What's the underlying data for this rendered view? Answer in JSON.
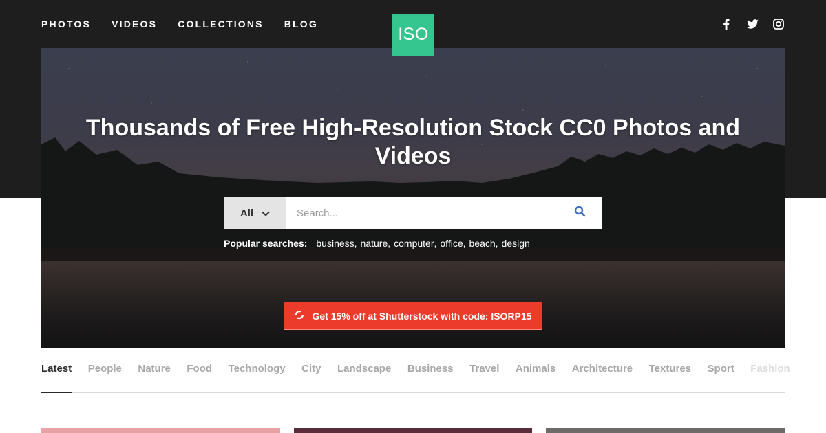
{
  "nav": {
    "links": [
      "PHOTOS",
      "VIDEOS",
      "COLLECTIONS",
      "BLOG"
    ]
  },
  "logo": {
    "text": "ISO",
    "color": "#35c58f"
  },
  "social": [
    "facebook-icon",
    "twitter-icon",
    "instagram-icon"
  ],
  "hero": {
    "title": "Thousands of Free High-Resolution Stock CC0 Photos and Videos"
  },
  "search": {
    "category": "All",
    "placeholder": "Search...",
    "icon": "search-icon",
    "icon_color": "#3b6fc0"
  },
  "popular": {
    "label": "Popular searches:",
    "terms": [
      "business",
      "nature",
      "computer",
      "office",
      "beach",
      "design"
    ]
  },
  "promo": {
    "label": "Get 15% off at Shutterstock with code: ISORP15",
    "color": "#ec3b2b"
  },
  "tabs": [
    "Latest",
    "People",
    "Nature",
    "Food",
    "Technology",
    "City",
    "Landscape",
    "Business",
    "Travel",
    "Animals",
    "Architecture",
    "Textures",
    "Sport",
    "Fashion"
  ],
  "active_tab": "Latest",
  "thumbnails": [
    "#e7a2a6",
    "#5a2b3a",
    "#6e6a68"
  ]
}
